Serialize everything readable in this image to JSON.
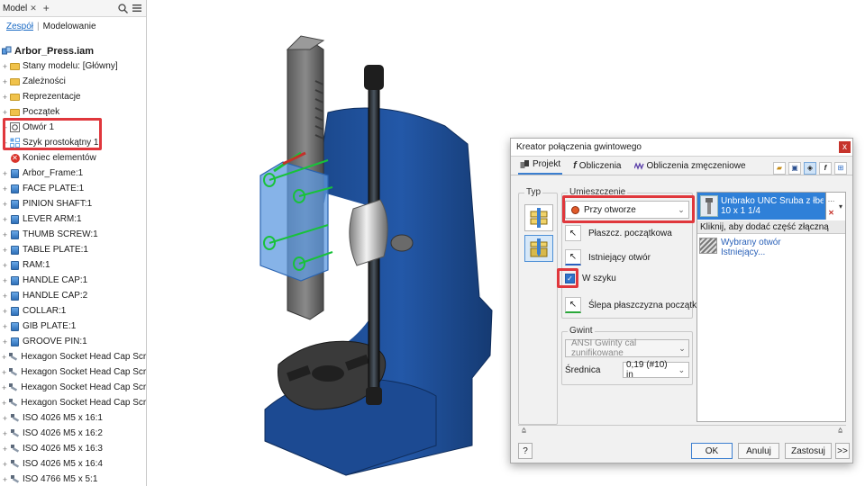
{
  "browser": {
    "tab_label": "Model",
    "close_glyph": "✕",
    "add_glyph": "+",
    "modes": [
      "Zespół",
      "Modelowanie"
    ],
    "root": "Arbor_Press.iam",
    "items": [
      {
        "label": "Stany modelu: [Główny]",
        "icon": "folder-icon",
        "expander": "+"
      },
      {
        "label": "Zależności",
        "icon": "folder-icon",
        "expander": "+"
      },
      {
        "label": "Reprezentacje",
        "icon": "folder-icon",
        "expander": "+"
      },
      {
        "label": "Początek",
        "icon": "folder-icon",
        "expander": "+"
      },
      {
        "label": "Otwór 1",
        "icon": "hole-feature-icon",
        "expander": "+"
      },
      {
        "label": "Szyk prostokątny 1",
        "icon": "rectangular-pattern-icon",
        "expander": "+"
      },
      {
        "label": "Koniec elementów",
        "icon": "end-of-features-icon",
        "expander": ""
      },
      {
        "label": "Arbor_Frame:1",
        "icon": "part-icon",
        "expander": "+"
      },
      {
        "label": "FACE PLATE:1",
        "icon": "part-icon",
        "expander": "+"
      },
      {
        "label": "PINION SHAFT:1",
        "icon": "part-icon",
        "expander": "+"
      },
      {
        "label": "LEVER ARM:1",
        "icon": "part-icon",
        "expander": "+"
      },
      {
        "label": "THUMB SCREW:1",
        "icon": "part-icon",
        "expander": "+"
      },
      {
        "label": "TABLE PLATE:1",
        "icon": "part-icon",
        "expander": "+"
      },
      {
        "label": "RAM:1",
        "icon": "part-icon",
        "expander": "+"
      },
      {
        "label": "HANDLE CAP:1",
        "icon": "part-icon",
        "expander": "+"
      },
      {
        "label": "HANDLE CAP:2",
        "icon": "part-icon",
        "expander": "+"
      },
      {
        "label": "COLLAR:1",
        "icon": "part-icon",
        "expander": "+"
      },
      {
        "label": "GIB PLATE:1",
        "icon": "part-icon",
        "expander": "+"
      },
      {
        "label": "GROOVE PIN:1",
        "icon": "part-icon",
        "expander": "+"
      },
      {
        "label": "Hexagon Socket Head Cap Screw - In",
        "icon": "screw-icon",
        "expander": "+"
      },
      {
        "label": "Hexagon Socket Head Cap Screw - In",
        "icon": "screw-icon",
        "expander": "+"
      },
      {
        "label": "Hexagon Socket Head Cap Screw - In",
        "icon": "screw-icon",
        "expander": "+"
      },
      {
        "label": "Hexagon Socket Head Cap Screw - In",
        "icon": "screw-icon",
        "expander": "+"
      },
      {
        "label": "ISO 4026 M5 x 16:1",
        "icon": "screw-icon",
        "expander": "+"
      },
      {
        "label": "ISO 4026 M5 x 16:2",
        "icon": "screw-icon",
        "expander": "+"
      },
      {
        "label": "ISO 4026 M5 x 16:3",
        "icon": "screw-icon",
        "expander": "+"
      },
      {
        "label": "ISO 4026 M5 x 16:4",
        "icon": "screw-icon",
        "expander": "+"
      },
      {
        "label": "ISO 4766 M5 x 5:1",
        "icon": "screw-icon",
        "expander": "+"
      }
    ]
  },
  "dialog": {
    "title": "Kreator połączenia gwintowego",
    "close_glyph": "x",
    "tabs": [
      {
        "label": "Projekt",
        "icon": "assembly-icon"
      },
      {
        "label": "Obliczenia",
        "icon": "fx-icon"
      },
      {
        "label": "Obliczenia zmęczeniowe",
        "icon": "fatigue-icon"
      }
    ],
    "typ_label": "Typ",
    "umieszczenie_label": "Umieszczenie",
    "placement_value": "Przy otworze",
    "pick_start_plane": "Płaszcz. początkowa",
    "pick_existing_hole": "Istniejący otwór",
    "pattern_checkbox_label": "W szyku",
    "pick_blind_plane": "Ślepa płaszczyzna początkowa",
    "gwint_label": "Gwint",
    "thread_value": "ANSI Gwinty cal zunifikowane",
    "diameter_label": "Średnica",
    "diameter_value": "0,19 (#10) in",
    "component_line1": "Unbrako UNC Śruba z łbem wa...",
    "component_line2": "10 x 1 1/4",
    "add_hint": "Kliknij, aby dodać część złączną",
    "hole_line1": "Wybrany otwór",
    "hole_line2": "Istniejący...",
    "ok": "OK",
    "cancel": "Anuluj",
    "apply": "Zastosuj",
    "more": ">>",
    "help_glyph": "?"
  },
  "colors": {
    "accent": "#2f80d8",
    "highlight_box": "#e0373c",
    "frame_blue": "#1e4a8c"
  }
}
